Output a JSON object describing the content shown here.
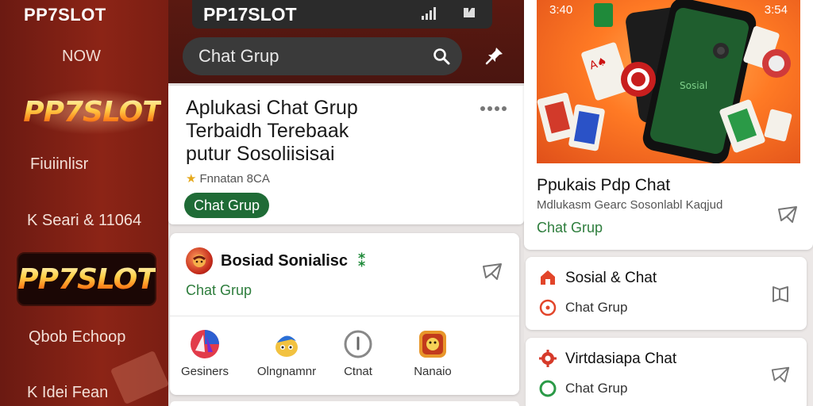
{
  "sidebar": {
    "brand": "PP7SLOT",
    "now": "NOW",
    "logo_top": "PP7SLOT",
    "item_1": "Fiuiinlisr",
    "item_2": "K Seari & 11064",
    "logo_bottom": "PP7SLOT",
    "item_3": "Qbob Echoop",
    "item_4": "K Idei Fean"
  },
  "middle": {
    "status_title": "PP17SLOT",
    "search_placeholder": "Chat Grup",
    "app_card": {
      "title_line1": "Aplukasi Chat Grup",
      "title_line2": "Terbaidh Terebaak",
      "title_line3": "putur Sosoliisisai",
      "rating_text": "Fnnatan 8CA",
      "chip": "Chat Grup"
    },
    "post_card": {
      "title": "Bosiad Sonialisc",
      "plus": "⁑",
      "subtitle": "Chat Grup",
      "quick_items": [
        {
          "label": "Gesiners",
          "icon": "colorful-app-icon"
        },
        {
          "label": "Olngnamnr",
          "icon": "character-app-icon"
        },
        {
          "label": "Ctnat",
          "icon": "info-circle-icon"
        },
        {
          "label": "Nanaio",
          "icon": "game-app-icon"
        }
      ]
    }
  },
  "right": {
    "hero": {
      "time_left": "3:40",
      "time_right": "3:54",
      "phone_label": "Sosial",
      "title": "Ppukais Pdp Chat",
      "description": "Mdlukasm Gearc Sosonlabl Kaqjud",
      "link": "Chat Grup"
    },
    "cards": [
      {
        "title": "Sosial & Chat",
        "subtitle": "Chat Grup",
        "top_icon": "home-icon",
        "bottom_icon": "circle-icon",
        "action_icon": "bookmark-icon"
      },
      {
        "title": "Virtdasiapa Chat",
        "subtitle": "Chat Grup",
        "top_icon": "gear-icon",
        "bottom_icon": "circle-icon",
        "action_icon": "share-icon"
      }
    ]
  },
  "colors": {
    "sidebar_bg": "#7a1d12",
    "accent_green": "#1f6b36",
    "link_green": "#2d7d3c",
    "hero_orange": "#ff7a24"
  }
}
